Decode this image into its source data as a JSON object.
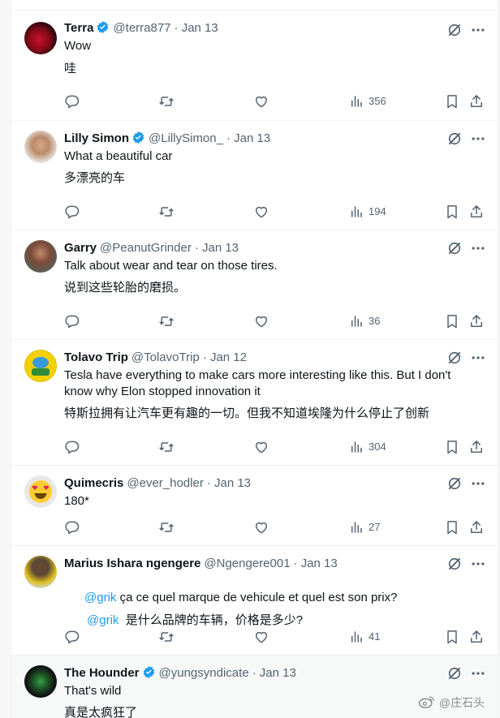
{
  "posts": [
    {
      "name": "Terra",
      "verified": true,
      "handle": "@terra877",
      "date": "· Jan 13",
      "text": "Wow",
      "translation": "哇",
      "views": "356",
      "avatar": "avatar-betta-fish",
      "avatar_color": "#3a0b10"
    },
    {
      "name": "Lilly Simon",
      "verified": true,
      "handle": "@LillySimon_",
      "date": "· Jan 13",
      "text": "What a beautiful car",
      "translation": "多漂亮的车",
      "views": "194",
      "avatar": "avatar-girl-photo",
      "avatar_color": "#b98a6a"
    },
    {
      "name": "Garry",
      "verified": false,
      "handle": "@PeanutGrinder",
      "date": "· Jan 13",
      "text": "Talk about wear and tear on those tires.",
      "translation": "说到这些轮胎的磨损。",
      "views": "36",
      "avatar": "avatar-man-photo",
      "avatar_color": "#7a4a3a"
    },
    {
      "name": "Tolavo Trip",
      "verified": false,
      "handle": "@TolavoTrip",
      "date": "· Jan 12",
      "text": "Tesla have everything to make cars more interesting like this. But I don't know why Elon stopped innovation it",
      "translation": "特斯拉拥有让汽车更有趣的一切。但我不知道埃隆为什么停止了创新",
      "views": "304",
      "avatar": "avatar-tolavo-logo",
      "avatar_color": "#f5d000"
    },
    {
      "name": "Quimecris",
      "verified": false,
      "handle": "@ever_hodler",
      "date": "· Jan 13",
      "text": "180*",
      "translation": "",
      "views": "27",
      "avatar": "avatar-heart-eyes-emoji",
      "avatar_color": "#e8e8e8"
    },
    {
      "name": "Marius Ishara ngengere",
      "verified": false,
      "handle": "@Ngengere001",
      "date": "· Jan 13",
      "mention": "@grik",
      "text": " ça ce quel marque de vehicule et quel est son prix?",
      "translation_mention": "@grik",
      "translation": "  是什么品牌的车辆，价格是多少?",
      "views": "41",
      "avatar": "avatar-man-yellow-shirt",
      "avatar_color": "#5b4636"
    },
    {
      "name": "The Hounder",
      "verified": true,
      "handle": "@yungsyndicate",
      "date": "· Jan 13",
      "text": "That's wild",
      "translation": "真是太疯狂了",
      "views": "",
      "avatar": "avatar-hound-character",
      "avatar_color": "#1b1b1b"
    }
  ],
  "watermark": "@庄石头",
  "colors": {
    "verified": "#1d9bf0",
    "icon": "#536471",
    "mention": "#1d9bf0"
  }
}
